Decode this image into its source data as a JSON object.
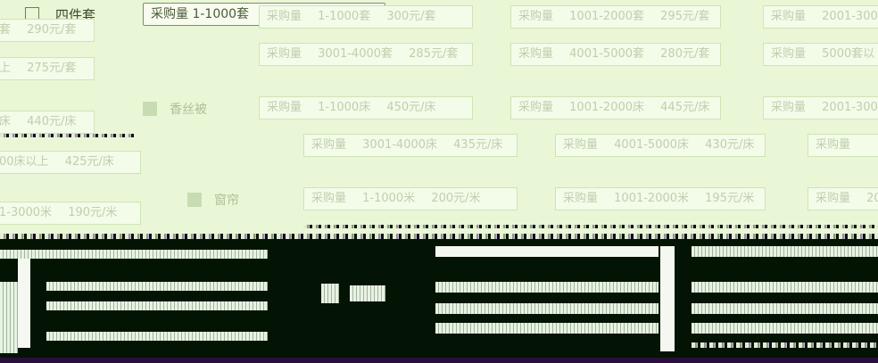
{
  "header": {
    "product": "四件套",
    "select_value": "采购量   1-1000套"
  },
  "sections": [
    {
      "name": "四件套",
      "tiers": [
        {
          "qty": "",
          "price": "290元/套",
          "visible_qty": "套"
        },
        {
          "qty": "",
          "price": "275元/套",
          "visible_qty": "上"
        },
        {
          "qty": "1-1000套",
          "price": "300元/套"
        },
        {
          "qty": "1001-2000套",
          "price": "295元/套"
        },
        {
          "qty": "2001-3000",
          "price": ""
        },
        {
          "qty": "3001-4000套",
          "price": "285元/套"
        },
        {
          "qty": "4001-5000套",
          "price": "280元/套"
        },
        {
          "qty": "5000套以",
          "price": ""
        }
      ]
    },
    {
      "name": "香丝被",
      "tiers": [
        {
          "qty": "1-1000床",
          "price": "450元/床"
        },
        {
          "qty": "1001-2000床",
          "price": "445元/床"
        },
        {
          "qty": "2001-300",
          "price": ""
        },
        {
          "qty": "",
          "price": "440元/床",
          "visible_qty": "床"
        },
        {
          "qty": "3001-4000床",
          "price": "435元/床"
        },
        {
          "qty": "4001-5000床",
          "price": "430元/床"
        },
        {
          "qty": "",
          "price": ""
        },
        {
          "qty": "00床以上",
          "price": "425元/床"
        }
      ]
    },
    {
      "name": "窗帘",
      "tiers": [
        {
          "qty": "1-1000米",
          "price": "200元/米"
        },
        {
          "qty": "1001-2000米",
          "price": "195元/米"
        },
        {
          "qty": "20",
          "price": ""
        },
        {
          "qty": "1-3000米",
          "price": "190元/米"
        }
      ]
    }
  ],
  "label": "采购量"
}
